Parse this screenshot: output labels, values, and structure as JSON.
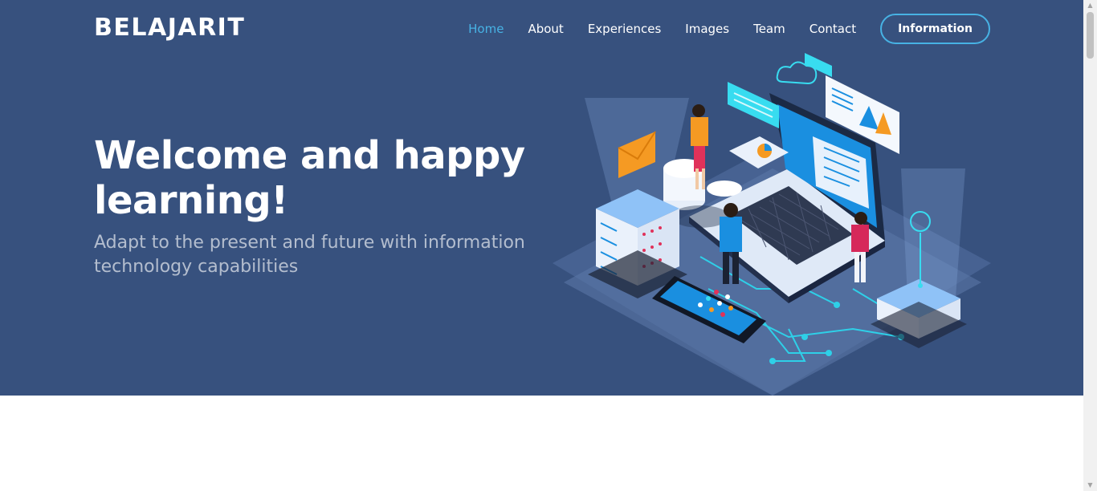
{
  "header": {
    "logo": "BELAJARIT",
    "nav": [
      {
        "label": "Home",
        "active": true
      },
      {
        "label": "About",
        "active": false
      },
      {
        "label": "Experiences",
        "active": false
      },
      {
        "label": "Images",
        "active": false
      },
      {
        "label": "Team",
        "active": false
      },
      {
        "label": "Contact",
        "active": false
      }
    ],
    "cta_label": "Information"
  },
  "hero": {
    "title": "Welcome and happy learning!",
    "subtitle": "Adapt to the present and future with information technology capabilities",
    "illustration_icon": "isometric-technology-illustration-icon"
  },
  "colors": {
    "hero_bg": "#37517e",
    "accent": "#47b2e4",
    "text": "#ffffff"
  }
}
